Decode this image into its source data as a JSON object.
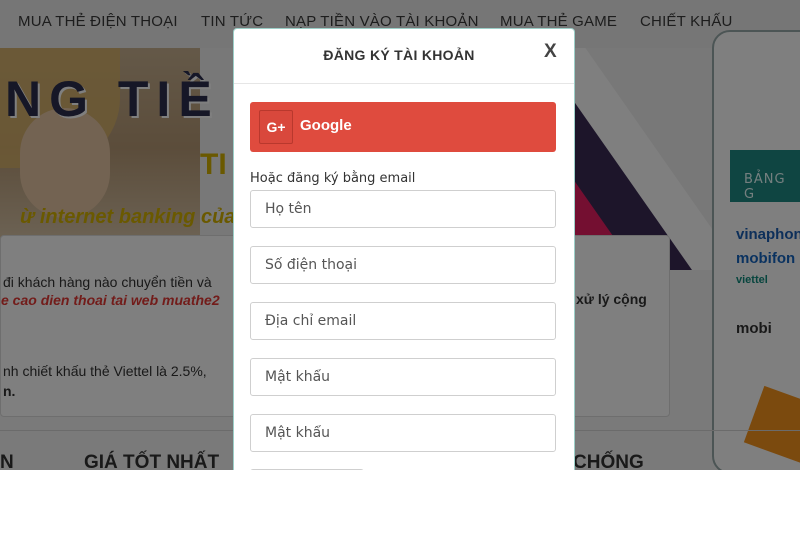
{
  "nav": {
    "items": [
      {
        "label": "MUA THẺ ĐIỆN THOẠI"
      },
      {
        "label": "TIN TỨC"
      },
      {
        "label": "NẠP TIỀN VÀO TÀI KHOẢN"
      },
      {
        "label": "MUA THẺ GAME"
      },
      {
        "label": "CHIẾT KHẤU"
      }
    ]
  },
  "banner": {
    "title": "NG TIỀ",
    "subtitle_1": "TI",
    "subtitle_2": "ừ internet banking của c",
    "phone_header": "BẢNG G",
    "operators": [
      "vinaphon",
      "mobifon",
      "viettel",
      "mobi"
    ]
  },
  "background_text": {
    "line_1": "đi khách hàng nào chuyển tiền và",
    "line_2": "e cao dien thoai tai web muathe2",
    "line_3": "xử lý cộng",
    "line_4": "nh chiết khấu thẻ Viettel là 2.5%,",
    "line_5": "n."
  },
  "bottom_headings": [
    "N",
    "GIÁ TỐT NHẤT",
    "CHỐNG"
  ],
  "modal": {
    "title": "ĐĂNG KÝ TÀI KHOẢN",
    "close_label": "X",
    "google_icon_text": "G+",
    "google_label": "Google",
    "or_email_text": "Hoặc đăng ký bằng email",
    "fields": [
      {
        "placeholder": "Họ tên"
      },
      {
        "placeholder": "Số điện thoại"
      },
      {
        "placeholder": "Địa chỉ email"
      },
      {
        "placeholder": "Mật khẩu"
      },
      {
        "placeholder": "Mật khẩu"
      }
    ]
  },
  "colors": {
    "google_red": "#df4b3e",
    "overlay": "rgba(0,0,0,0.5)",
    "banner_pink": "#e91e63",
    "phone_teal": "#1e8a84"
  }
}
